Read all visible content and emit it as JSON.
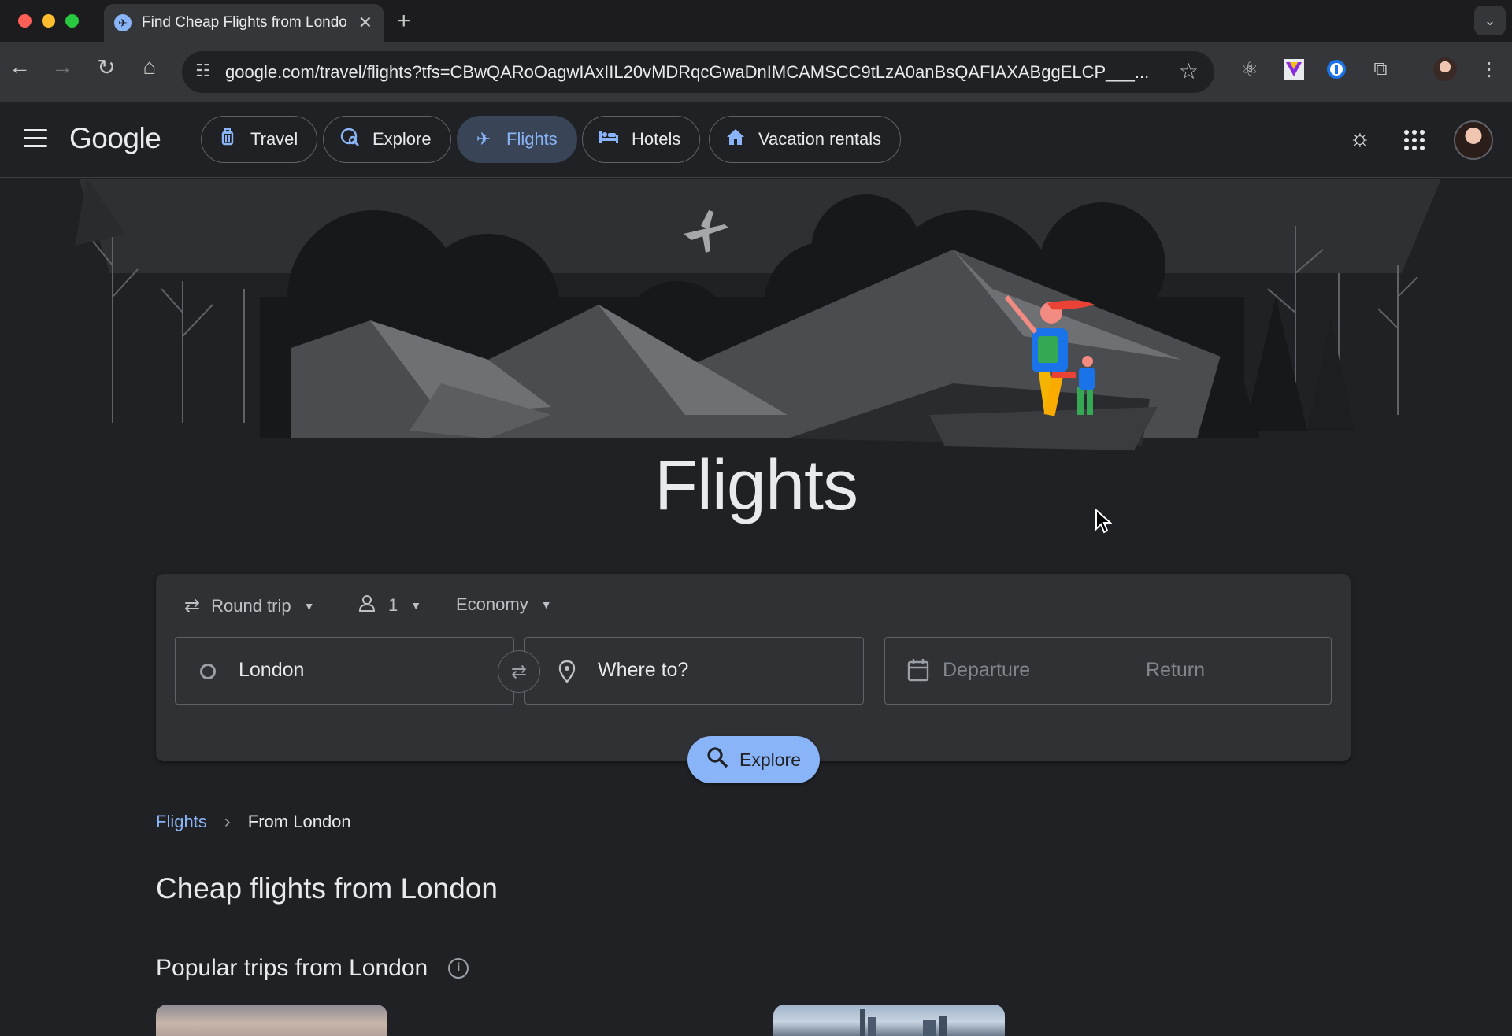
{
  "browser": {
    "tab_title": "Find Cheap Flights from London",
    "tab_close": "✕",
    "new_tab": "+",
    "tab_menu": "⌄",
    "url": "google.com/travel/flights?tfs=CBwQARoOagwIAxIIL20vMDRqcGwaDnIMCAMSCC9tLzA0anBsQAFIAXABggELCP___..."
  },
  "header": {
    "logo": "Google",
    "nav": [
      {
        "label": "Travel",
        "icon": "luggage-icon"
      },
      {
        "label": "Explore",
        "icon": "explore-globe-icon"
      },
      {
        "label": "Flights",
        "icon": "plane-icon"
      },
      {
        "label": "Hotels",
        "icon": "bed-icon"
      },
      {
        "label": "Vacation rentals",
        "icon": "house-icon"
      }
    ]
  },
  "hero": {
    "title": "Flights"
  },
  "search": {
    "trip_type": "Round trip",
    "passengers": "1",
    "cabin_class": "Economy",
    "origin": "London",
    "destination_placeholder": "Where to?",
    "departure_placeholder": "Departure",
    "return_placeholder": "Return",
    "explore_button": "Explore"
  },
  "breadcrumb": {
    "root": "Flights",
    "current": "From London"
  },
  "sections": {
    "cheap_title": "Cheap flights from London",
    "popular_title": "Popular trips from London"
  },
  "colors": {
    "accent": "#8ab4f8",
    "background": "#202124",
    "card": "#303134",
    "text": "#e8eaed"
  }
}
